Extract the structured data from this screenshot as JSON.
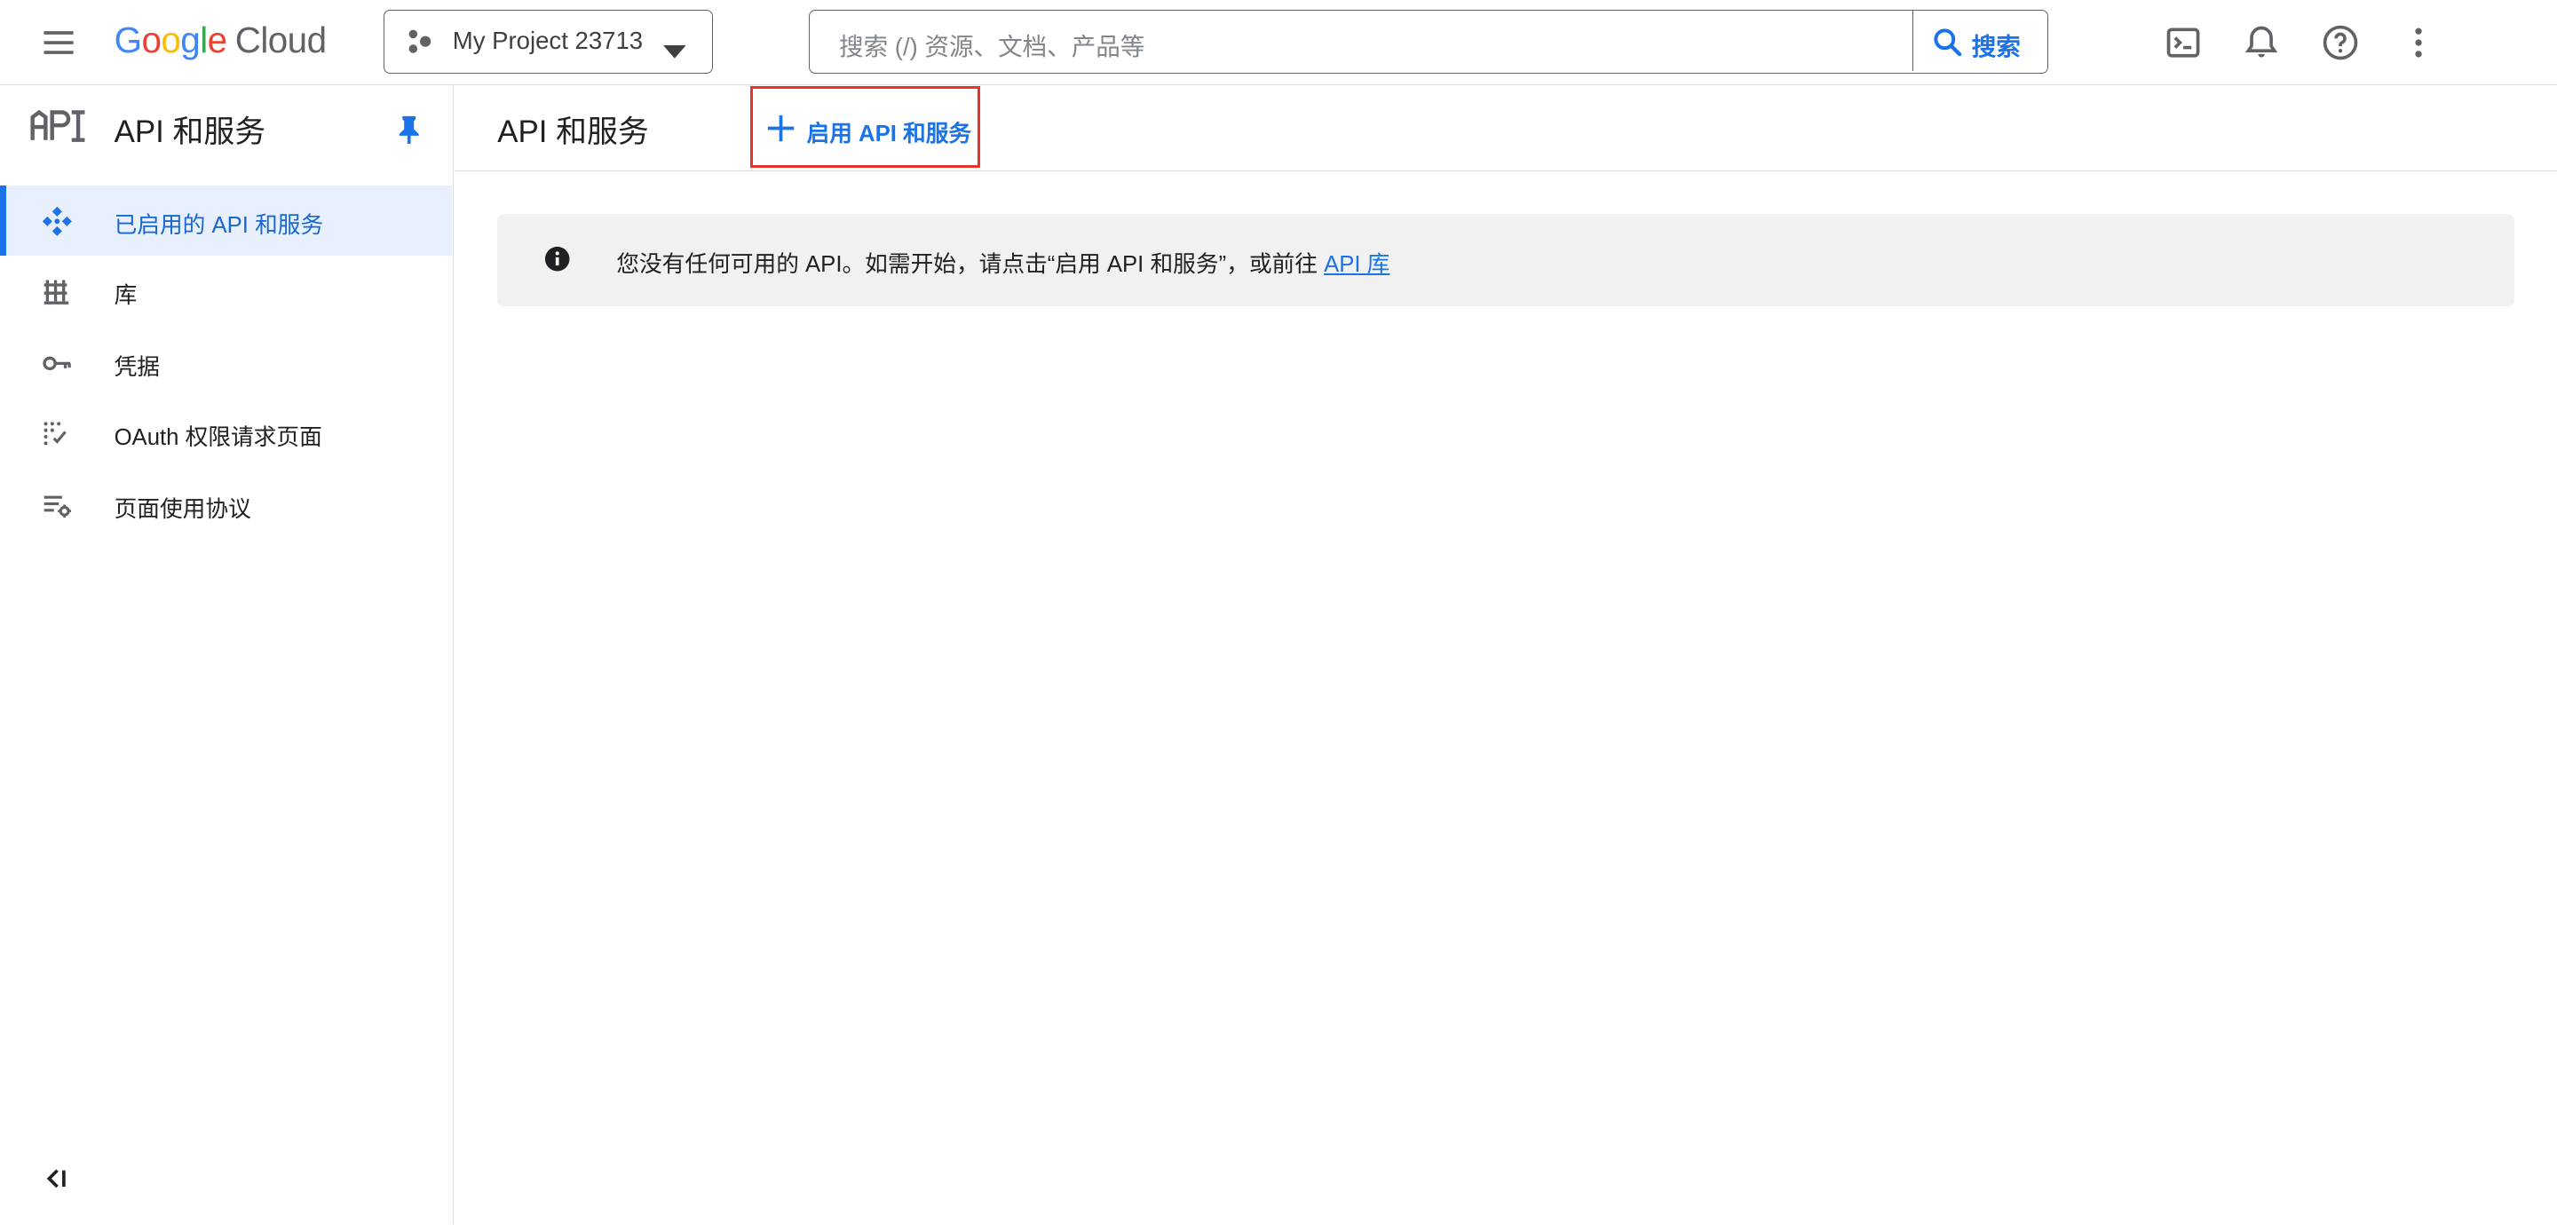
{
  "topbar": {
    "logo_google": "Google",
    "logo_cloud": "Cloud",
    "project_name": "My Project 23713",
    "search_placeholder": "搜索 (/) 资源、文档、产品等",
    "search_button_label": "搜索",
    "icons": [
      "menu-icon",
      "cloud-shell-icon",
      "bell-icon",
      "help-icon",
      "more-vert-icon"
    ]
  },
  "sidebar": {
    "title": "API 和服务",
    "items": [
      {
        "label": "已启用的 API 和服务",
        "icon": "api-services-icon",
        "active": true
      },
      {
        "label": "库",
        "icon": "library-icon",
        "active": false
      },
      {
        "label": "凭据",
        "icon": "key-icon",
        "active": false
      },
      {
        "label": "OAuth 权限请求页面",
        "icon": "oauth-consent-icon",
        "active": false
      },
      {
        "label": "页面使用协议",
        "icon": "page-usage-icon",
        "active": false
      }
    ]
  },
  "main": {
    "title": "API 和服务",
    "enable_button": "启用 API 和服务",
    "banner_text": "您没有任何可用的 API。如需开始，请点击“启用 API 和服务”，或前往 ",
    "banner_link": "API 库"
  },
  "colors": {
    "accent": "#1a73e8",
    "highlight_box": "#e8332a",
    "active_bg": "#e8f0fe",
    "banner_bg": "#f1f1f1"
  }
}
